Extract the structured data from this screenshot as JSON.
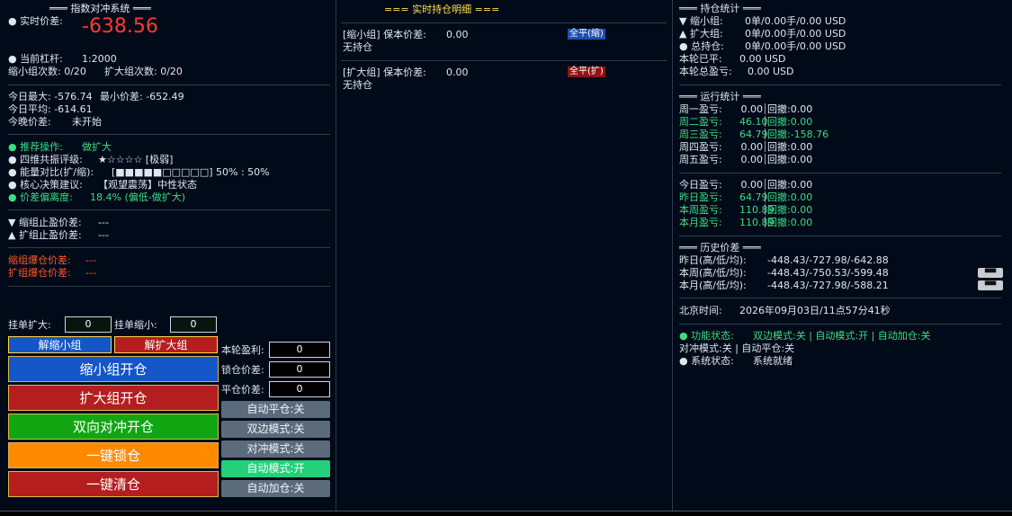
{
  "left": {
    "title": "═══ 指数对冲系统 ═══",
    "realtime_label": "● 实时价差:",
    "realtime_value": "-638.56",
    "leverage_label": "● 当前杠杆:",
    "leverage_value": "1:2000",
    "shrink_count": "缩小组次数: 0/20",
    "expand_count": "扩大组次数: 0/20",
    "today_max": "今日最大: -576.74",
    "min_spread": "最小价差: -652.49",
    "today_avg": "今日平均: -614.61",
    "tonight_label": "今晚价差:",
    "tonight_value": "未开始",
    "recommend_label": "● 推荐操作:",
    "recommend_value": "做扩大",
    "resonance_label": "● 四维共振评级:",
    "resonance_value": "★☆☆☆☆ [极弱]",
    "energy_label": "● 能量对比(扩/缩):",
    "energy_value": "[■■■■■□□□□□] 50% : 50%",
    "core_label": "● 核心决策建议:",
    "core_value": "【观望震荡】中性状态",
    "deviation_label": "● 价差偏离度:",
    "deviation_value": "18.4% (偏低-做扩大)",
    "shrink_tp_label": "▼ 缩组止盈价差:",
    "shrink_tp_value": "---",
    "expand_tp_label": "▲ 扩组止盈价差:",
    "expand_tp_value": "---",
    "shrink_liq_label": "缩组爆仓价差:",
    "shrink_liq_value": "---",
    "expand_liq_label": "扩组爆仓价差:",
    "expand_liq_value": "---",
    "pending_expand_label": "挂单扩大:",
    "pending_expand_value": "0",
    "pending_shrink_label": "挂单缩小:",
    "pending_shrink_value": "0",
    "unlock_shrink": "解缩小组",
    "unlock_expand": "解扩大组",
    "round_profit_label": "本轮盈利:",
    "round_profit_value": "0",
    "lock_spread_label": "锁仓价差:",
    "lock_spread_value": "0",
    "close_spread_label": "平仓价差:",
    "close_spread_value": "0",
    "btn_shrink_open": "缩小组开仓",
    "btn_expand_open": "扩大组开仓",
    "btn_dual_open": "双向对冲开仓",
    "btn_lock": "一键锁仓",
    "btn_clear": "一键清仓",
    "toggle_auto_close": "自动平仓:关",
    "toggle_dual_mode": "双边模式:关",
    "toggle_hedge_mode": "对冲模式:关",
    "toggle_auto_mode": "自动模式:开",
    "toggle_auto_add": "自动加仓:关"
  },
  "middle": {
    "title": "=== 实时持仓明细 ===",
    "shrink_group_label": "[缩小组] 保本价差:",
    "shrink_group_value": "0.00",
    "shrink_group_status": "无持仓",
    "shrink_close_btn": "全平(缩)",
    "expand_group_label": "[扩大组] 保本价差:",
    "expand_group_value": "0.00",
    "expand_group_status": "无持仓",
    "expand_close_btn": "全平(扩)"
  },
  "right": {
    "pos_title": "═══ 持仓统计 ═══",
    "pos_shrink_label": "▼ 缩小组:",
    "pos_shrink_value": "0单/0.00手/0.00 USD",
    "pos_expand_label": "▲ 扩大组:",
    "pos_expand_value": "0单/0.00手/0.00 USD",
    "pos_total_label": "● 总持仓:",
    "pos_total_value": "0单/0.00手/0.00 USD",
    "round_closed_label": "本轮已平:",
    "round_closed_value": "0.00 USD",
    "round_total_label": "本轮总盈亏:",
    "round_total_value": "0.00 USD",
    "run_title": "═══ 运行统计 ═══",
    "weekdays": [
      {
        "label": "周一盈亏:",
        "value": "0.00",
        "dd": "回撤:0.00",
        "color": "#dfe6ee"
      },
      {
        "label": "周二盈亏:",
        "value": "46.10",
        "dd": "回撤:0.00",
        "color": "#3ddc84"
      },
      {
        "label": "周三盈亏:",
        "value": "64.79",
        "dd": "回撤:-158.76",
        "color": "#3ddc84"
      },
      {
        "label": "周四盈亏:",
        "value": "0.00",
        "dd": "回撤:0.00",
        "color": "#dfe6ee"
      },
      {
        "label": "周五盈亏:",
        "value": "0.00",
        "dd": "回撤:0.00",
        "color": "#dfe6ee"
      }
    ],
    "periods": [
      {
        "label": "今日盈亏:",
        "value": "0.00",
        "dd": "回撤:0.00",
        "color": "#dfe6ee"
      },
      {
        "label": "昨日盈亏:",
        "value": "64.79",
        "dd": "回撤:0.00",
        "color": "#3ddc84"
      },
      {
        "label": "本周盈亏:",
        "value": "110.89",
        "dd": "回撤:0.00",
        "color": "#3ddc84"
      },
      {
        "label": "本月盈亏:",
        "value": "110.89",
        "dd": "回撤:0.00",
        "color": "#3ddc84"
      }
    ],
    "hist_title": "═══ 历史价差 ═══",
    "hist_yesterday_label": "昨日(高/低/均):",
    "hist_yesterday_value": "-448.43/-727.98/-642.88",
    "hist_week_label": "本周(高/低/均):",
    "hist_week_value": "-448.43/-750.53/-599.48",
    "hist_month_label": "本月(高/低/均):",
    "hist_month_value": "-448.43/-727.98/-588.21",
    "beijing_label": "北京时间:",
    "beijing_value": "2026年09月03日/11点57分41秒",
    "func_label": "● 功能状态:",
    "func_value": "双边模式:关 | 自动模式:开 | 自动加仓:关",
    "func_line2": "对冲模式:关 | 自动平仓:关",
    "sys_label": "● 系统状态:",
    "sys_value": "系统就绪",
    "mini_btn_glyph": "▀▀"
  }
}
